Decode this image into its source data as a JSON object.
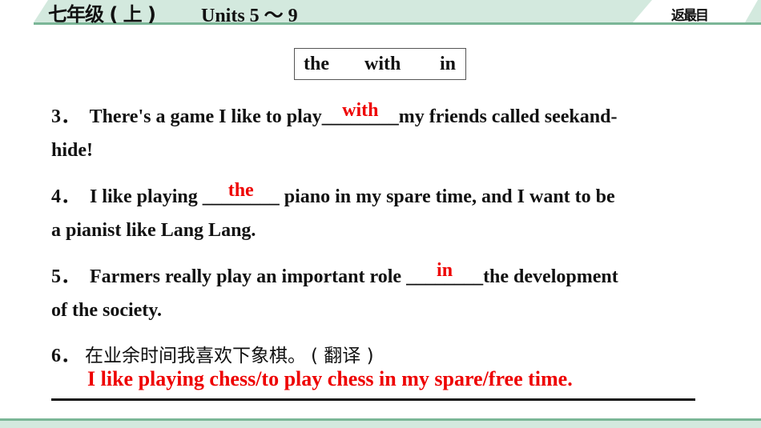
{
  "header": {
    "title": "七年级 ( 上 )",
    "units": "Units 5 ～ 9",
    "back_label": "返最目"
  },
  "word_box": {
    "words": [
      "the",
      "with",
      "in"
    ]
  },
  "questions": [
    {
      "num": "3．",
      "before": "There's a game I like to play",
      "blank": "________",
      "answer": "with",
      "after": "my friends called seekand-",
      "line2": "hide!"
    },
    {
      "num": "4．",
      "before": "I like playing ",
      "blank": "________",
      "answer": "the",
      "after": " piano in my spare time, and I want to be",
      "line2": "a pianist like Lang Lang."
    },
    {
      "num": "5．",
      "before": "Farmers really play an important role ",
      "blank": "________",
      "answer": "in",
      "after": "the development",
      "line2": "of the society."
    },
    {
      "num": "6．",
      "prompt": "在业余时间我喜欢下象棋。",
      "tag": "( 翻译 )",
      "answer": "I like playing chess/to play chess in my spare/free time."
    }
  ],
  "colors": {
    "accent_green": "#7bb697",
    "band_green": "#d3e9de",
    "answer_red": "#ee0000"
  }
}
